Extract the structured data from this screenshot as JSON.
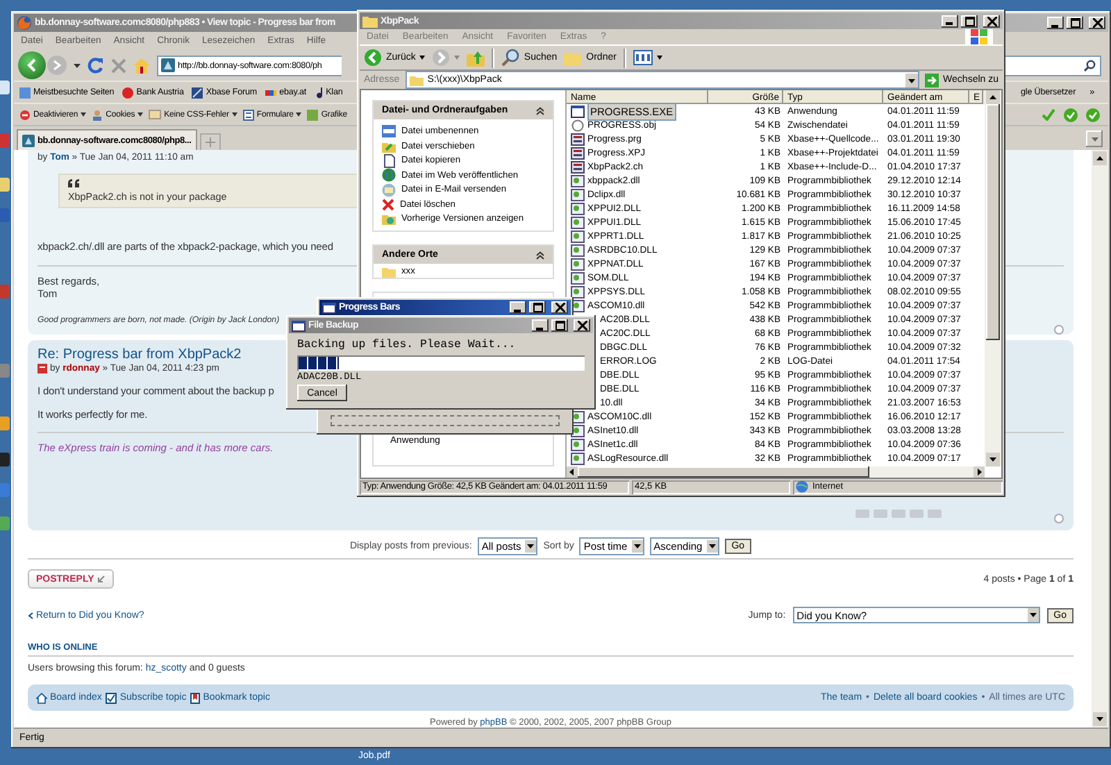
{
  "browser": {
    "title": "bb.donnay-software.comc8080/php883 • View topic - Progress bar from",
    "active": false,
    "menu": [
      "Datei",
      "Bearbeiten",
      "Ansicht",
      "Chronik",
      "Lesezeichen",
      "Extras",
      "Hilfe"
    ],
    "url": "http://bb.donnay-software.com:8080/ph",
    "bookmarks": [
      {
        "label": "Meistbesuchte Seiten",
        "kind": "page"
      },
      {
        "label": "Bank Austria",
        "kind": "bank"
      },
      {
        "label": "Xbase Forum",
        "kind": "forum"
      },
      {
        "label": "ebay.at",
        "kind": "shop"
      },
      {
        "label": "Klan",
        "kind": "note"
      }
    ],
    "bookmarks_more": "gle Übersetzer",
    "chevron": "»",
    "devbar": [
      {
        "label": "Deaktivieren",
        "kind": "stop",
        "dropdown": true
      },
      {
        "label": "Cookies",
        "kind": "person",
        "dropdown": true
      },
      {
        "label": "Keine CSS-Fehler",
        "kind": "mail",
        "dropdown": true
      },
      {
        "label": "Formulare",
        "kind": "form",
        "dropdown": true
      },
      {
        "label": "Grafike",
        "kind": "image",
        "dropdown": false
      }
    ],
    "tab": "bb.donnay-software.comc8080/php8...",
    "status": "Fertig"
  },
  "posts": [
    {
      "by": "by",
      "author": "Tom",
      "color": "#105289",
      "date": "» Tue Jan 04, 2011 11:10 am",
      "quote": "XbpPack2.ch is not in your package",
      "paragraphs": [
        "xbpack2.ch/.dll are parts of the xbpack2-package, which you need"
      ],
      "closing": [
        "Best regards,",
        "Tom"
      ],
      "signature": {
        "text": "Good programmers are born, not made. (Origin by Jack London)",
        "color": "#333333"
      }
    },
    {
      "title": "Re: Progress bar from XbpPack2",
      "by": "by",
      "author": "rdonnay",
      "color": "#aa0000",
      "date": "» Tue Jan 04, 2011 4:23 pm",
      "paragraphs": [
        "I don't understand your comment about the backup p",
        "It works perfectly for me."
      ],
      "signature": {
        "text": "The eXpress train is coming - and it has more cars.",
        "color": "#8f3fa0"
      }
    }
  ],
  "sort_bar": [
    {
      "kind": "label",
      "text": "Display posts from previous:"
    },
    {
      "kind": "select",
      "text": "All posts"
    },
    {
      "kind": "label",
      "text": "Sort by"
    },
    {
      "kind": "select",
      "text": "Post time"
    },
    {
      "kind": "select",
      "text": "Ascending"
    },
    {
      "kind": "button",
      "text": "Go"
    }
  ],
  "reply_button": "POSTREPLY",
  "pagination": "4 posts • Page **1** of **1**",
  "return_link": "Return to Did you Know?",
  "jump_label": "Jump to:",
  "jump_select": "Did you Know?",
  "jump_go": "Go",
  "online_heading": "WHO IS ONLINE",
  "online_prefix": "Users browsing this forum:",
  "online_user": "hz_scotty",
  "online_suffix": "and 0 guests",
  "navbar_left": [
    {
      "label": "Board index",
      "kind": "home"
    },
    {
      "label": "Subscribe topic",
      "kind": "check"
    },
    {
      "label": "Bookmark topic",
      "kind": "bookmark"
    }
  ],
  "navbar_right": [
    {
      "kind": "link",
      "text": "The team"
    },
    {
      "kind": "sep",
      "text": "•"
    },
    {
      "kind": "link",
      "text": "Delete all board cookies"
    },
    {
      "kind": "sep",
      "text": "•"
    },
    {
      "kind": "text",
      "text": "All times are UTC"
    }
  ],
  "powered_prefix": "Powered by",
  "powered_link": "phpBB",
  "powered_suffix": "© 2000, 2002, 2005, 2007 phpBB Group",
  "explorer": {
    "title": "XbpPack",
    "active": false,
    "menu": [
      "Datei",
      "Bearbeiten",
      "Ansicht",
      "Favoriten",
      "Extras",
      "?"
    ],
    "back": "Zurück",
    "search": "Suchen",
    "folders": "Ordner",
    "address_label": "Adresse",
    "address": "S:\\(xxx)\\XbpPack",
    "go": "Wechseln zu",
    "task_groups": [
      {
        "title": "Datei- und Ordneraufgaben",
        "items": [
          {
            "label": "Datei umbenennen",
            "kind": "rename"
          },
          {
            "label": "Datei verschieben",
            "kind": "move"
          },
          {
            "label": "Datei kopieren",
            "kind": "copy"
          },
          {
            "label": "Datei im Web veröffentlichen",
            "kind": "web"
          },
          {
            "label": "Datei in E-Mail versenden",
            "kind": "mail"
          },
          {
            "label": "Datei löschen",
            "kind": "delete"
          },
          {
            "label": "Vorherige Versionen anzeigen",
            "kind": "versions"
          }
        ]
      },
      {
        "title": "Andere Orte",
        "items": [
          {
            "label": "xxx",
            "kind": "folder"
          }
        ]
      }
    ],
    "details_text": "Anwendung",
    "columns": [
      "Name",
      "Größe",
      "Typ",
      "Geändert am",
      "E"
    ],
    "files": [
      {
        "name": "PROGRESS.EXE",
        "size": "43 KB",
        "type": "Anwendung",
        "modified": "04.01.2011 11:59",
        "kind": "exe",
        "selected": true
      },
      {
        "name": "PROGRESS.obj",
        "size": "54 KB",
        "type": "Zwischendatei",
        "modified": "04.01.2011 11:59",
        "kind": "obj",
        "selected": false
      },
      {
        "name": "Progress.prg",
        "size": "5 KB",
        "type": "Xbase++-Quellcode...",
        "modified": "03.01.2011 19:30",
        "kind": "xpp",
        "selected": false
      },
      {
        "name": "Progress.XPJ",
        "size": "1 KB",
        "type": "Xbase++-Projektdatei",
        "modified": "04.01.2011 11:59",
        "kind": "xpp",
        "selected": false
      },
      {
        "name": "XbpPack2.ch",
        "size": "1 KB",
        "type": "Xbase++-Include-D...",
        "modified": "01.04.2010 17:37",
        "kind": "xpp",
        "selected": false
      },
      {
        "name": "xbppack2.dll",
        "size": "109 KB",
        "type": "Programmbibliothek",
        "modified": "29.12.2010 12:14",
        "kind": "dll",
        "selected": false
      },
      {
        "name": "Dclipx.dll",
        "size": "10.681 KB",
        "type": "Programmbibliothek",
        "modified": "30.12.2010 10:37",
        "kind": "dll",
        "selected": false
      },
      {
        "name": "XPPUI2.DLL",
        "size": "1.200 KB",
        "type": "Programmbibliothek",
        "modified": "16.11.2009 14:58",
        "kind": "dll",
        "selected": false
      },
      {
        "name": "XPPUI1.DLL",
        "size": "1.615 KB",
        "type": "Programmbibliothek",
        "modified": "15.06.2010 17:45",
        "kind": "dll",
        "selected": false
      },
      {
        "name": "XPPRT1.DLL",
        "size": "1.817 KB",
        "type": "Programmbibliothek",
        "modified": "21.06.2010 10:25",
        "kind": "dll",
        "selected": false
      },
      {
        "name": "ASRDBC10.DLL",
        "size": "129 KB",
        "type": "Programmbibliothek",
        "modified": "10.04.2009 07:37",
        "kind": "dll",
        "selected": false
      },
      {
        "name": "XPPNAT.DLL",
        "size": "167 KB",
        "type": "Programmbibliothek",
        "modified": "10.04.2009 07:37",
        "kind": "dll",
        "selected": false
      },
      {
        "name": "SOM.DLL",
        "size": "194 KB",
        "type": "Programmbibliothek",
        "modified": "10.04.2009 07:37",
        "kind": "dll",
        "selected": false
      },
      {
        "name": "XPPSYS.DLL",
        "size": "1.058 KB",
        "type": "Programmbibliothek",
        "modified": "08.02.2010 09:55",
        "kind": "dll",
        "selected": false
      },
      {
        "name": "ASCOM10.dll",
        "size": "542 KB",
        "type": "Programmbibliothek",
        "modified": "10.04.2009 07:37",
        "kind": "dll",
        "selected": false
      },
      {
        "name": "AC20B.DLL",
        "size": "438 KB",
        "type": "Programmbibliothek",
        "modified": "10.04.2009 07:37",
        "kind": "covered",
        "selected": false
      },
      {
        "name": "AC20C.DLL",
        "size": "68 KB",
        "type": "Programmbibliothek",
        "modified": "10.04.2009 07:37",
        "kind": "covered",
        "selected": false
      },
      {
        "name": "DBGC.DLL",
        "size": "76 KB",
        "type": "Programmbibliothek",
        "modified": "10.04.2009 07:32",
        "kind": "covered",
        "selected": false
      },
      {
        "name": "ERROR.LOG",
        "size": "2 KB",
        "type": "LOG-Datei",
        "modified": "04.01.2011 17:54",
        "kind": "covered",
        "selected": false
      },
      {
        "name": "DBE.DLL",
        "size": "95 KB",
        "type": "Programmbibliothek",
        "modified": "10.04.2009 07:37",
        "kind": "covered",
        "selected": false
      },
      {
        "name": "DBE.DLL",
        "size": "116 KB",
        "type": "Programmbibliothek",
        "modified": "10.04.2009 07:37",
        "kind": "covered",
        "selected": false
      },
      {
        "name": "10.dll",
        "size": "34 KB",
        "type": "Programmbibliothek",
        "modified": "21.03.2007 16:53",
        "kind": "covered",
        "selected": false
      },
      {
        "name": "ASCOM10C.dll",
        "size": "152 KB",
        "type": "Programmbibliothek",
        "modified": "16.06.2010 12:17",
        "kind": "dll",
        "selected": false
      },
      {
        "name": "ASInet10.dll",
        "size": "343 KB",
        "type": "Programmbibliothek",
        "modified": "03.03.2008 13:28",
        "kind": "dll",
        "selected": false
      },
      {
        "name": "ASInet1c.dll",
        "size": "84 KB",
        "type": "Programmbibliothek",
        "modified": "10.04.2009 07:36",
        "kind": "dll",
        "selected": false
      },
      {
        "name": "ASLogResource.dll",
        "size": "32 KB",
        "type": "Programmbibliothek",
        "modified": "10.04.2009 07:17",
        "kind": "dll",
        "selected": false
      }
    ],
    "status": [
      "Typ: Anwendung Größe: 42,5 KB Geändert am: 04.01.2011 11:59",
      "42,5 KB",
      "Internet"
    ]
  },
  "progress_window": {
    "title": "Progress Bars",
    "active": true,
    "level": 0
  },
  "backup_dialog": {
    "title": "File Backup",
    "active": false,
    "message": "Backing up files. Please Wait...",
    "level": 0.14,
    "file": "ADAC20B.DLL",
    "cancel": "Cancel"
  },
  "desktop_label": "Job.pdf"
}
